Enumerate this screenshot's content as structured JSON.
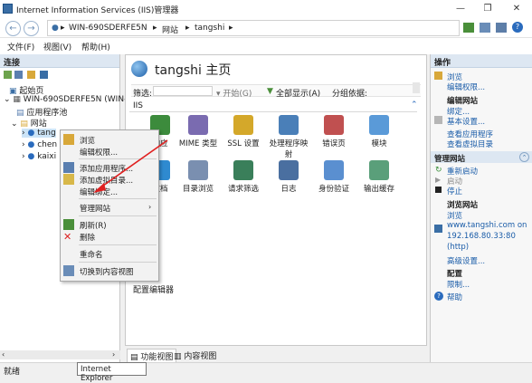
{
  "window": {
    "title": "Internet Information Services (IIS)管理器"
  },
  "address": {
    "crumbs": [
      "WIN-690SDERFE5N",
      "网站",
      "tangshi"
    ]
  },
  "menu": [
    "文件(F)",
    "视图(V)",
    "帮助(H)"
  ],
  "connections": {
    "header": "连接",
    "tree": {
      "start": "起始页",
      "server": "WIN-690SDERFE5N (WIN-",
      "apppools": "应用程序池",
      "sites": "网站",
      "site1": "tang",
      "site2": "chen",
      "site3": "kaixi"
    }
  },
  "center": {
    "title": "tangshi 主页",
    "filter_label": "筛选:",
    "start_btn": "▾ 开始(G)",
    "showall_btn": "全部显示(A)",
    "group_label": "分组依据:",
    "section": "IIS",
    "icons_row1": [
      "响应",
      "MIME 类型",
      "SSL 设置",
      "处理程序映射",
      "错误页",
      "模块"
    ],
    "icons_row2": [
      "文档",
      "目录浏览",
      "请求筛选",
      "日志",
      "身份验证",
      "输出缓存"
    ],
    "partial_label": "器",
    "config_editor": "配置编辑器",
    "tabs": {
      "features": "功能视图",
      "content": "内容视图"
    }
  },
  "actions": {
    "header": "操作",
    "items": {
      "explore": "浏览",
      "edit_perm": "编辑权限...",
      "edit_site": "编辑网站",
      "bindings": "绑定...",
      "basic": "基本设置...",
      "view_apps": "查看应用程序",
      "view_vdirs": "查看虚拟目录",
      "manage": "管理网站",
      "restart": "重新启动",
      "start": "启动",
      "stop": "停止",
      "browse_site": "浏览网站",
      "browse": "浏览",
      "url1": "www.tangshi.com on",
      "url2": "192.168.80.33:80",
      "url3": "(http)",
      "advanced": "高级设置...",
      "config": "配置",
      "limits": "限制...",
      "help": "帮助"
    }
  },
  "context_menu": {
    "items": [
      "浏览",
      "编辑权限...",
      "添加应用程序...",
      "添加虚拟目录...",
      "编辑绑定...",
      "管理网站",
      "刷新(R)",
      "删除",
      "重命名",
      "切换到内容视图"
    ]
  },
  "status": {
    "text": "就绪",
    "tooltip": "Internet Explorer"
  },
  "colors": {
    "accent": "#1a5ca8",
    "header": "#dde7f2"
  }
}
